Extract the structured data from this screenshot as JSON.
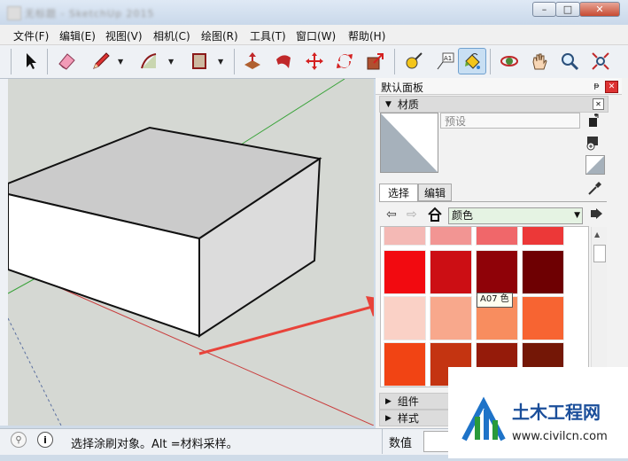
{
  "window": {
    "title": "无标题 - SketchUp 2015",
    "buttons": {
      "minimize": "–",
      "maximize": "□",
      "close": "✕"
    }
  },
  "menu": [
    "文件(F)",
    "编辑(E)",
    "视图(V)",
    "相机(C)",
    "绘图(R)",
    "工具(T)",
    "窗口(W)",
    "帮助(H)"
  ],
  "toolbar": {
    "tools": [
      "select-arrow-icon",
      "eraser-icon",
      "pencil-line-icon",
      "arc-icon",
      "rectangle-icon",
      "push-pull-icon",
      "follow-me-icon",
      "move-icon",
      "rotate-icon",
      "scale-icon",
      "tape-measure-icon",
      "text-label-icon",
      "paint-bucket-icon",
      "orbit-icon",
      "pan-hand-icon",
      "zoom-icon",
      "zoom-extents-icon"
    ],
    "active": "paint-bucket-icon",
    "text_tool_glyph": "A1"
  },
  "panel": {
    "title": "默认面板",
    "pin": "ᵽ",
    "close": "✕",
    "materials": {
      "header": "材质",
      "name_placeholder": "预设",
      "tabs": [
        "选择",
        "编辑"
      ],
      "collection": "颜色",
      "tooltip": "A07 色",
      "swatch_colors": [
        [
          "#f4b9b5",
          "#f29593",
          "#f0676a",
          "#ec3838"
        ],
        [
          "#f20a10",
          "#cc0e14",
          "#8f0208",
          "#6e0002"
        ],
        [
          "#fad1c6",
          "#f8a88c",
          "#f88d5f",
          "#f76432"
        ],
        [
          "#f14414",
          "#c43411",
          "#951b0a",
          "#741706"
        ]
      ]
    },
    "components_header": "组件",
    "styles_header": "样式"
  },
  "status": {
    "text": "选择涂刷对象。Alt =材料采样。",
    "measurement_label": "数值"
  },
  "watermark": {
    "cn": "土木工程网",
    "url": "www.civilcn.com"
  },
  "colors": {
    "accent_arrow": "#e8433a",
    "swatch_selected_green": "#e5f3e3",
    "axis_red": "#c93b3b",
    "axis_green": "#3aa33a"
  }
}
